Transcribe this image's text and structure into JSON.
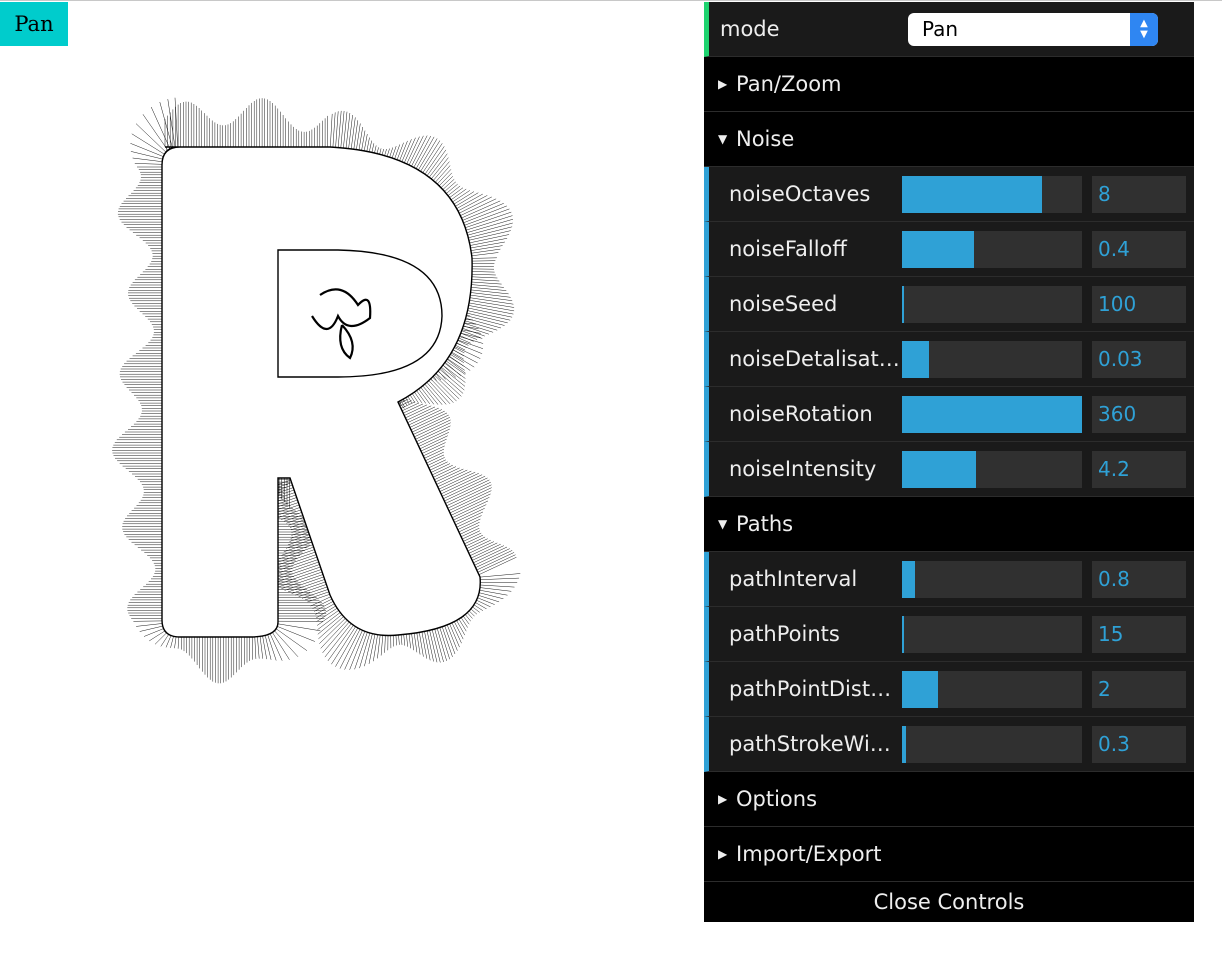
{
  "mode_tag": "Pan",
  "gui": {
    "mode": {
      "label": "mode",
      "value": "Pan"
    },
    "folders": {
      "panzoom": {
        "title": "Pan/Zoom",
        "open": false
      },
      "noise": {
        "title": "Noise",
        "open": true
      },
      "paths": {
        "title": "Paths",
        "open": true
      },
      "options": {
        "title": "Options",
        "open": false
      },
      "importexport": {
        "title": "Import/Export",
        "open": false
      }
    },
    "noise": [
      {
        "label": "noiseOctaves",
        "value": "8",
        "level": 0.78
      },
      {
        "label": "noiseFalloff",
        "value": "0.4",
        "level": 0.4
      },
      {
        "label": "noiseSeed",
        "value": "100",
        "level": 0.0
      },
      {
        "label": "noiseDetalisation",
        "value": "0.03",
        "level": 0.15
      },
      {
        "label": "noiseRotation",
        "value": "360",
        "level": 1.0
      },
      {
        "label": "noiseIntensity",
        "value": "4.2",
        "level": 0.41
      }
    ],
    "paths": [
      {
        "label": "pathInterval",
        "value": "0.8",
        "level": 0.07
      },
      {
        "label": "pathPoints",
        "value": "15",
        "level": 0.01
      },
      {
        "label": "pathPointDistance",
        "value": "2",
        "level": 0.2
      },
      {
        "label": "pathStrokeWidth",
        "value": "0.3",
        "level": 0.02
      }
    ],
    "close_label": "Close Controls"
  },
  "colors": {
    "accent": "#2fa1d6",
    "mode_tag": "#00cccc",
    "mode_bar": "#1ed36f"
  }
}
